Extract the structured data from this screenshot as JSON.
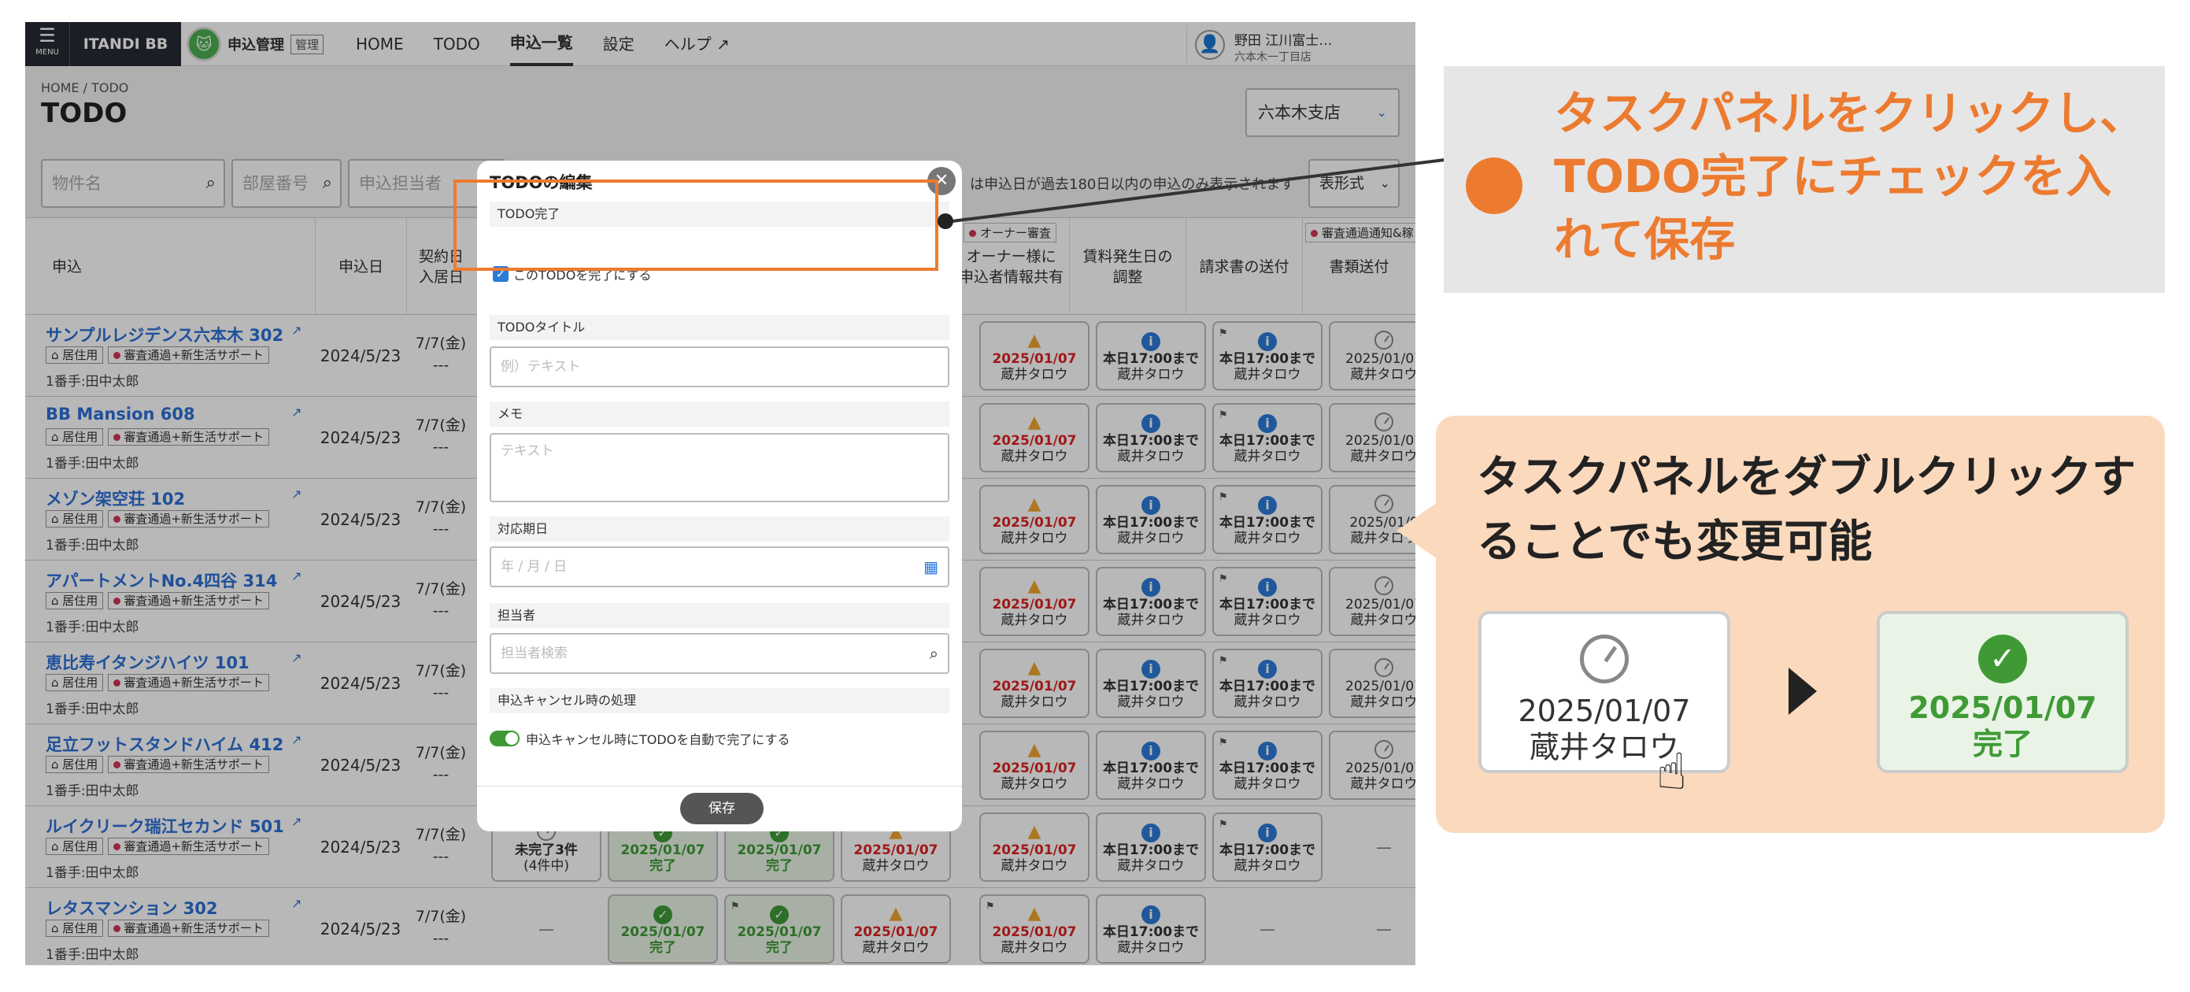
{
  "nav": {
    "menu_label": "MENU",
    "brand": "ITANDI BB",
    "app_name": "申込管理",
    "app_badge": "管理",
    "links": [
      "HOME",
      "TODO",
      "申込一覧",
      "設定",
      "ヘルプ"
    ],
    "active_link": "申込一覧",
    "user_name": "野田 江川富士…",
    "user_store": "六本木一丁目店"
  },
  "page": {
    "breadcrumb": "HOME  /  TODO",
    "title": "TODO",
    "branch": "六本木支店",
    "notice": "は申込日が過去180日以内の申込のみ表示されます",
    "view_mode": "表形式"
  },
  "filters": {
    "property_placeholder": "物件名",
    "room_placeholder": "部屋番号",
    "staff_placeholder": "申込担当者"
  },
  "table": {
    "headers": {
      "application": "申込",
      "date": "申込日",
      "contract": "契約日\n入居日",
      "owner_share": "オーナー様に\n申込者情報共有",
      "rent_adjust": "賃料発生日の\n調整",
      "invoice": "請求書の送付",
      "docs": "書類送付"
    },
    "legend_owner": "オーナー審査",
    "legend_notice": "審査通過通知&稼"
  },
  "rows": [
    {
      "name": "サンプルレジデンス六本木 302",
      "use": "居住用",
      "status": "審査通過+新生活サポート",
      "person": "1番手:田中太郎",
      "date": "2024/5/23",
      "contract": "7/7(金)",
      "movein": "---"
    },
    {
      "name": "BB Mansion 608",
      "use": "居住用",
      "status": "審査通過+新生活サポート",
      "person": "1番手:田中太郎",
      "date": "2024/5/23",
      "contract": "7/7(金)",
      "movein": "---"
    },
    {
      "name": "メゾン架空荘 102",
      "use": "居住用",
      "status": "審査通過+新生活サポート",
      "person": "1番手:田中太郎",
      "date": "2024/5/23",
      "contract": "7/7(金)",
      "movein": "---"
    },
    {
      "name": "アパートメントNo.4四谷 314",
      "use": "居住用",
      "status": "審査通過+新生活サポート",
      "person": "1番手:田中太郎",
      "date": "2024/5/23",
      "contract": "7/7(金)",
      "movein": "---"
    },
    {
      "name": "恵比寿イタンジハイツ 101",
      "use": "居住用",
      "status": "審査通過+新生活サポート",
      "person": "1番手:田中太郎",
      "date": "2024/5/23",
      "contract": "7/7(金)",
      "movein": "---"
    },
    {
      "name": "足立フットスタンドハイム 412",
      "use": "居住用",
      "status": "審査通過+新生活サポート",
      "person": "1番手:田中太郎",
      "date": "2024/5/23",
      "contract": "7/7(金)",
      "movein": "---"
    },
    {
      "name": "ルイクリーク瑞江セカンド 501",
      "use": "居住用",
      "status": "審査通過+新生活サポート",
      "person": "1番手:田中太郎",
      "date": "2024/5/23",
      "contract": "7/7(金)",
      "movein": "---"
    },
    {
      "name": "レタスマンション 302",
      "use": "居住用",
      "status": "審査通過+新生活サポート",
      "person": "1番手:田中太郎",
      "date": "2024/5/23",
      "contract": "7/7(金)",
      "movein": "---"
    }
  ],
  "tiles": {
    "overdue_date": "2025/01/07",
    "overdue_person": "蔵井タロウ",
    "today_label": "本日17:00まで",
    "today_person": "蔵井タロウ",
    "pending_date": "2025/01/07",
    "pending_person": "蔵井タロウ",
    "pending_date_cut": "2025/01/0",
    "done_date": "2025/01/07",
    "done_label": "完了",
    "incomplete_label": "未完了3件",
    "incomplete_sub": "(4件中)",
    "dash": "—"
  },
  "modal": {
    "title": "TODOの編集",
    "sec_done": "TODO完了",
    "done_checkbox": "このTODOを完了にする",
    "sec_title": "TODOタイトル",
    "title_placeholder": "例）テキスト",
    "sec_memo": "メモ",
    "memo_placeholder": "テキスト",
    "sec_due": "対応期日",
    "due_placeholder": "年 / 月 / 日",
    "sec_assignee": "担当者",
    "assignee_placeholder": "担当者検索",
    "sec_cancel": "申込キャンセル時の処理",
    "cancel_toggle": "申込キャンセル時にTODOを自動で完了にする",
    "save": "保存"
  },
  "callout1": {
    "text": "タスクパネルをクリックし、TODO完了にチェックを入れて保存",
    "color": "#ec7b30"
  },
  "callout2": {
    "text": "タスクパネルをダブルクリックすることでも変更可能",
    "before_date": "2025/01/07",
    "before_person": "蔵井タロウ",
    "after_date": "2025/01/07",
    "after_label": "完了"
  },
  "colors": {
    "accent": "#ec7b30",
    "link": "#2b6fd6",
    "success": "#3f9a35",
    "alert": "#d22222"
  }
}
